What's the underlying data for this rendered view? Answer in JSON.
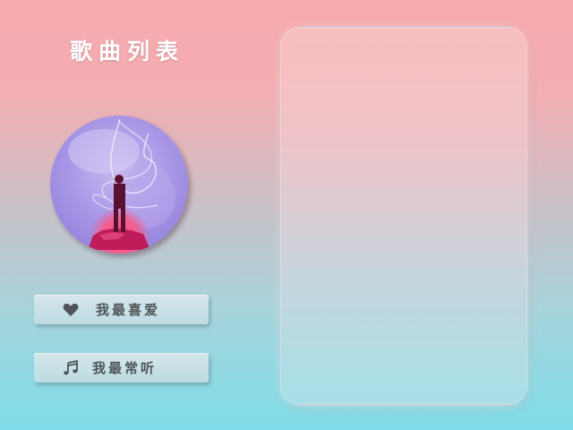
{
  "page": {
    "title": "歌曲列表"
  },
  "sidebar": {
    "buttons": [
      {
        "label": "我最喜爱",
        "icon": "heart-icon"
      },
      {
        "label": "我最常听",
        "icon": "music-note-icon"
      }
    ]
  },
  "album": {
    "cover_icon": "album-cover-art"
  },
  "colors": {
    "background_top": "#f7a9ad",
    "background_bottom": "#7edde8",
    "title": "#ffffff",
    "button_text": "#4f5556"
  }
}
